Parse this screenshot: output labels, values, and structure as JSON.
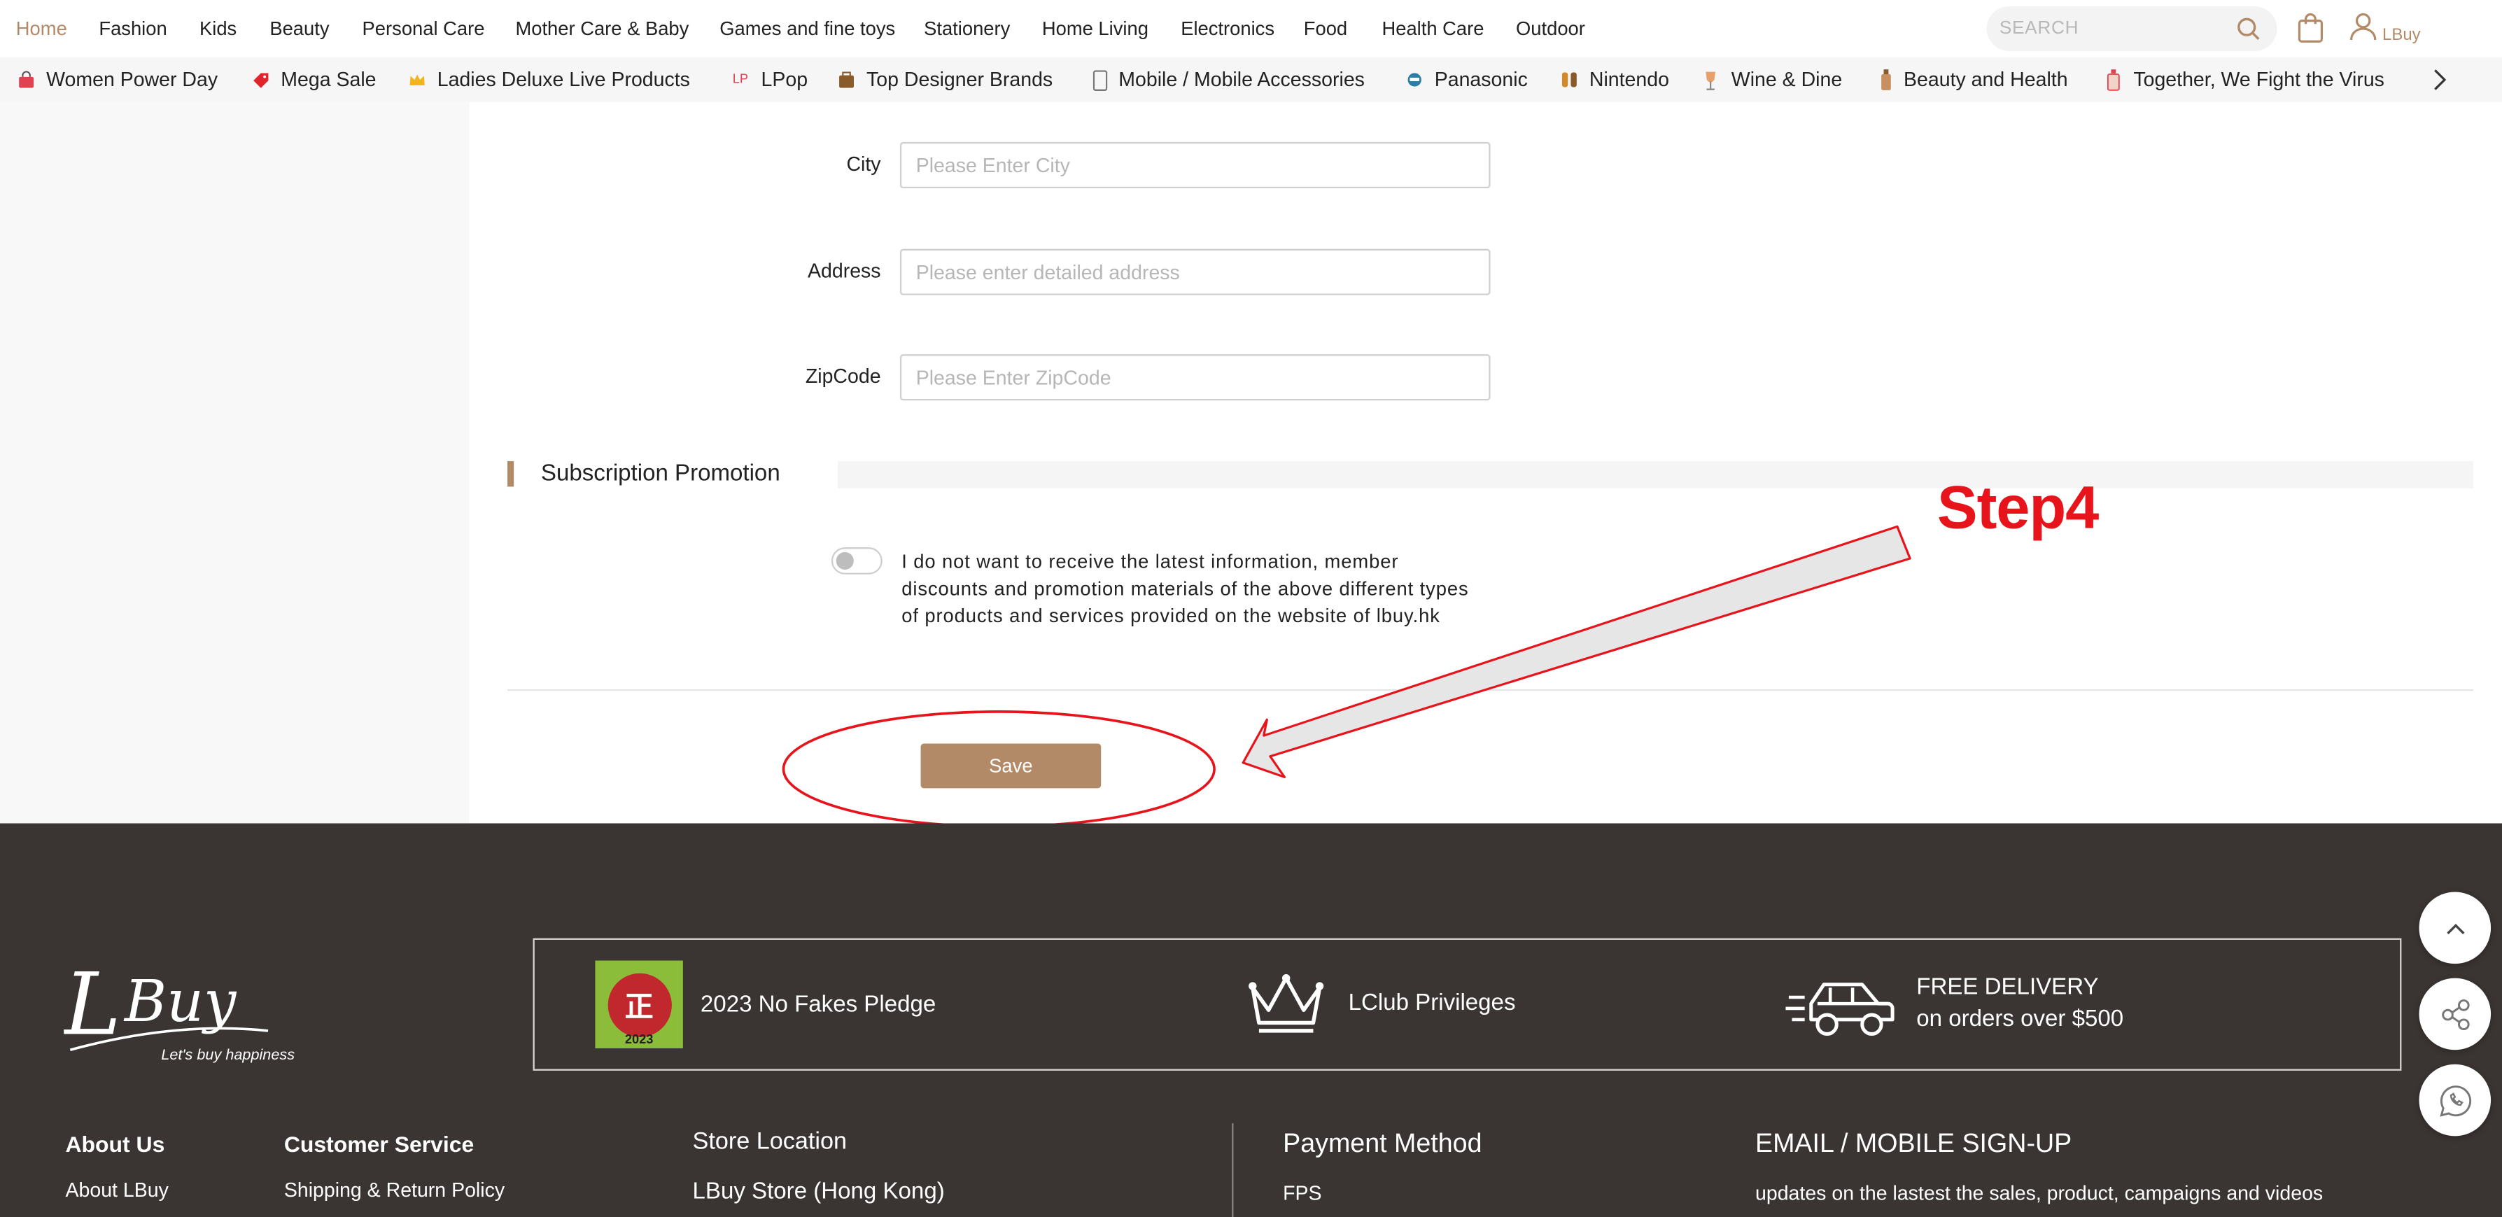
{
  "nav": {
    "items": [
      "Home",
      "Fashion",
      "Kids",
      "Beauty",
      "Personal Care",
      "Mother Care & Baby",
      "Games and fine toys",
      "Stationery",
      "Home Living",
      "Electronics",
      "Food",
      "Health Care",
      "Outdoor"
    ],
    "active": "Home",
    "search_placeholder": "SEARCH",
    "username": "LBuy"
  },
  "categories": [
    {
      "label": "Women Power Day",
      "icon": "handbag-icon"
    },
    {
      "label": "Mega Sale",
      "icon": "sale-tag-icon"
    },
    {
      "label": "Ladies Deluxe Live Products",
      "icon": "crown-icon"
    },
    {
      "label": "LPop",
      "icon": "lp-icon"
    },
    {
      "label": "Top Designer Brands",
      "icon": "brand-bag-icon"
    },
    {
      "label": "Mobile / Mobile Accessories",
      "icon": "phone-icon"
    },
    {
      "label": "Panasonic",
      "icon": "appliance-icon"
    },
    {
      "label": "Nintendo",
      "icon": "game-console-icon"
    },
    {
      "label": "Wine & Dine",
      "icon": "wine-glass-icon"
    },
    {
      "label": "Beauty and Health",
      "icon": "bottle-icon"
    },
    {
      "label": "Together, We Fight the Virus",
      "icon": "sanitizer-icon"
    }
  ],
  "form": {
    "city_label": "City",
    "city_placeholder": "Please Enter City",
    "address_label": "Address",
    "address_placeholder": "Please enter detailed address",
    "zipcode_label": "ZipCode",
    "zipcode_placeholder": "Please Enter ZipCode",
    "section_title": "Subscription Promotion",
    "opt_out_text": "I do not want to receive the latest information, member discounts and promotion materials of the above different types of products and services provided on the website of lbuy.hk",
    "opt_out_enabled": false,
    "save_label": "Save"
  },
  "annotation": {
    "step_label": "Step4",
    "color": "#e8141c"
  },
  "footer": {
    "logo_text": "LBuy",
    "tagline": "Let's buy happiness",
    "pledge": "2023 No Fakes Pledge",
    "seal_char": "正",
    "seal_year": "2023",
    "lclub": "LClub Privileges",
    "delivery_line1": "FREE DELIVERY",
    "delivery_line2": "on orders over $500",
    "about_heading": "About Us",
    "about_link": "About LBuy",
    "service_heading": "Customer Service",
    "service_link": "Shipping & Return Policy",
    "store_heading": "Store Location",
    "store_link": "LBuy Store (Hong Kong)",
    "payment_heading": "Payment Method",
    "payment_link": "FPS",
    "signup_heading": "EMAIL / MOBILE SIGN-UP",
    "signup_text": "updates on the lastest the sales, product, campaigns and videos"
  },
  "colors": {
    "accent": "#b38a68",
    "footer_bg": "#3a3432"
  }
}
